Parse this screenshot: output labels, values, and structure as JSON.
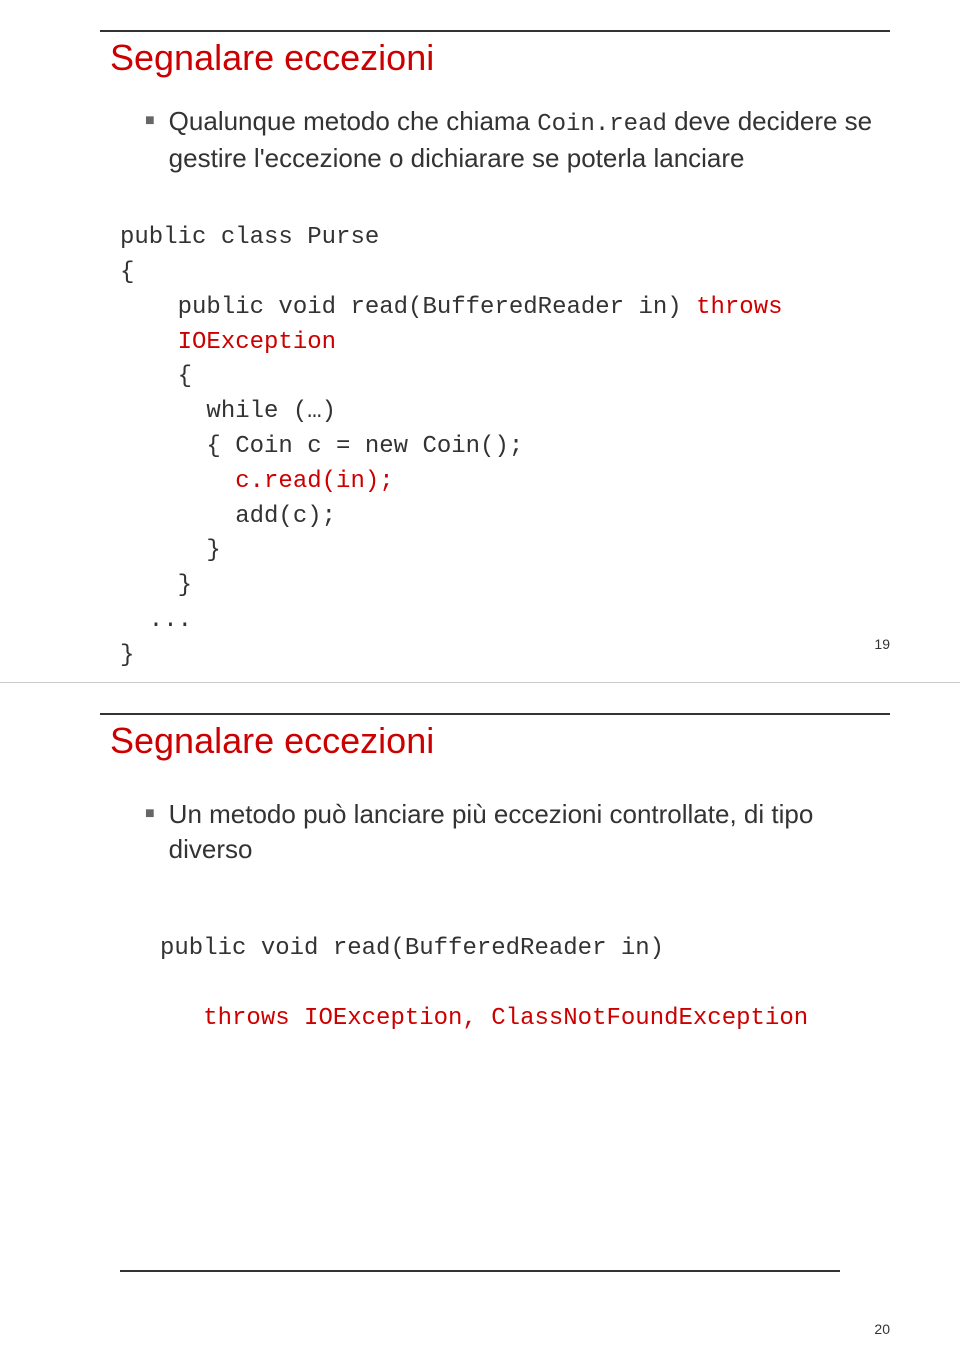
{
  "slide1": {
    "title": "Segnalare eccezioni",
    "bullet_pre": "Qualunque metodo che chiama ",
    "bullet_code": "Coin.read",
    "bullet_post": " deve decidere se gestire l'eccezione o dichiarare se poterla lanciare",
    "code": {
      "l1": "public class Purse",
      "l2": "{",
      "l3a": "    public void read(BufferedReader in) ",
      "l3b": "throws",
      "l4": "    IOException",
      "l5": "    {",
      "l6": "      while (…)",
      "l7": "      { Coin c = new Coin();",
      "l8a": "        ",
      "l8b": "c.read(in);",
      "l9": "        add(c);",
      "l10": "      }",
      "l11": "    }",
      "l12": "  ...",
      "l13": "}"
    },
    "page": "19"
  },
  "slide2": {
    "title": "Segnalare eccezioni",
    "bullet": "Un metodo può lanciare più eccezioni controllate, di tipo diverso",
    "code": {
      "l1": "public void read(BufferedReader in)",
      "l2a": "   ",
      "l2b": "throws IOException, ClassNotFoundException"
    },
    "page": "20"
  }
}
